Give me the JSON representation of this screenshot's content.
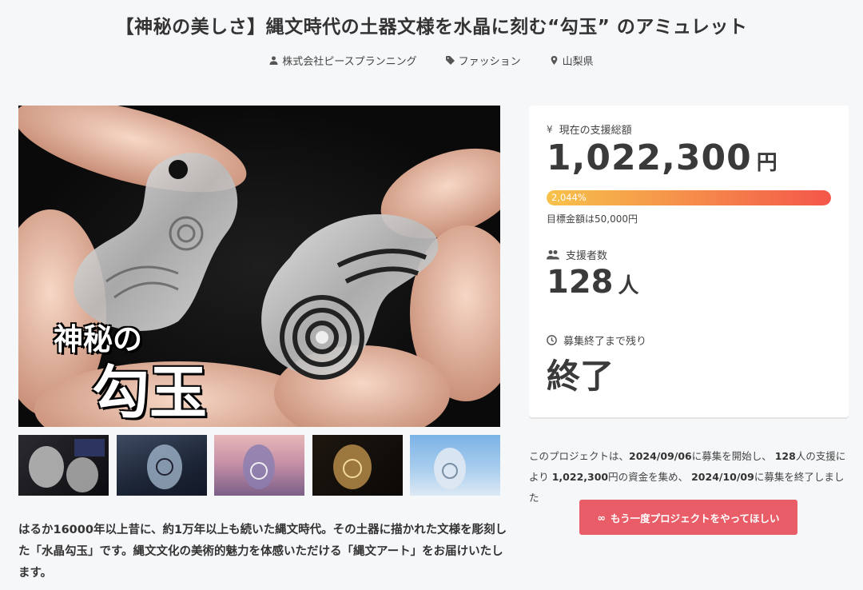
{
  "header": {
    "title": "【神秘の美しさ】縄文時代の土器文様を水晶に刻む“勾玉” のアミュレット",
    "company": "株式会社ピースプランニング",
    "category": "ファッション",
    "location": "山梨県"
  },
  "media": {
    "overlay_line1": "神秘の",
    "overlay_line2": "勾玉",
    "thumbnails": [
      "thumb-1",
      "thumb-2",
      "thumb-3",
      "thumb-4",
      "thumb-5"
    ]
  },
  "description": "はるか16000年以上昔に、約1万年以上も続いた縄文時代。その土器に描かれた文様を彫刻した「水晶勾玉」です。縄文文化の美術的魅力を体感いただける「縄文アート」をお届けいたします。",
  "stats": {
    "total_label": "現在の支援総額",
    "total_amount": "1,022,300",
    "currency_unit": "円",
    "progress_percent_text": "2,044%",
    "progress_value": 1.0,
    "goal_text": "目標金額は50,000円",
    "supporters_label": "支援者数",
    "supporters_count": "128",
    "supporters_unit": "人",
    "remaining_label": "募集終了まで残り",
    "remaining_value": "終了"
  },
  "summary": {
    "p1": "このプロジェクトは、",
    "start_date": "2024/09/06",
    "p2": "に募集を開始し、 ",
    "supporters": "128",
    "p3": "人の支援により ",
    "amount": "1,022,300",
    "p4": "円の資金を集め、 ",
    "end_date": "2024/10/09",
    "p5": "に募集を終了しました"
  },
  "cta": {
    "label": "もう一度プロジェクトをやってほしい",
    "icon": "∞"
  },
  "colors": {
    "cta": "#e85d67",
    "progress_start": "#f7c24a",
    "progress_end": "#f4564a"
  }
}
